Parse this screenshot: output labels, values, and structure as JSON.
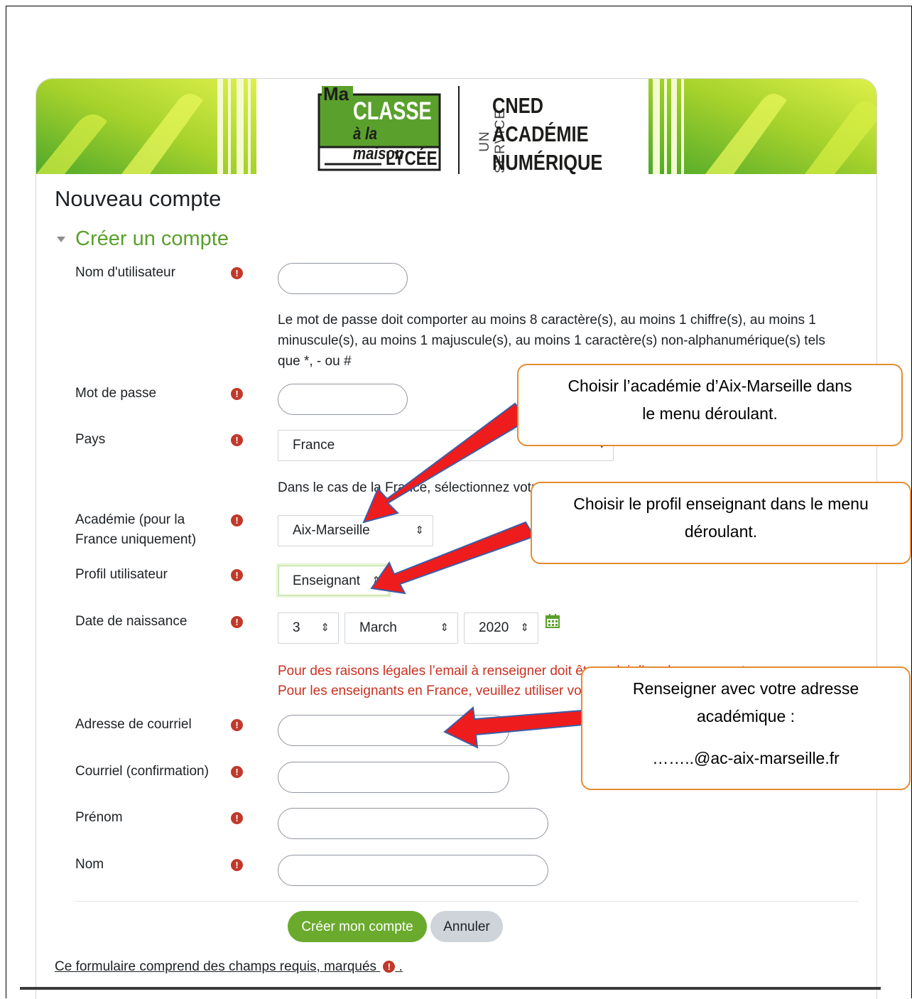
{
  "header": {
    "logo": {
      "line1": "Ma",
      "line2": "CLASSE",
      "line3": "à la maison",
      "line4": "LYCÉE"
    },
    "service_label": "UN SERVICE",
    "org_lines": [
      "CNED",
      "ACADÉMIE",
      "NUMÉRIQUE"
    ]
  },
  "page_title": "Nouveau compte",
  "section_title": "Créer un compte",
  "fields": {
    "username": {
      "label": "Nom d'utilisateur",
      "value": ""
    },
    "password_rule": "Le mot de passe doit comporter au moins 8 caractère(s), au moins 1 chiffre(s), au moins 1 minuscule(s), au moins 1 majuscule(s), au moins 1 caractère(s) non-alphanumérique(s) tels que *, - ou #",
    "password": {
      "label": "Mot de passe",
      "value": ""
    },
    "country": {
      "label": "Pays",
      "value": "France"
    },
    "country_help": "Dans le cas de la France, sélectionnez votre académie",
    "academy": {
      "label_line1": "Académie (pour la",
      "label_line2": "France uniquement)",
      "value": "Aix-Marseille"
    },
    "profile": {
      "label": "Profil utilisateur",
      "value": "Enseignant"
    },
    "birthdate": {
      "label": "Date de naissance",
      "day": "3",
      "month": "March",
      "year": "2020"
    },
    "email_notice_line1": "Pour des raisons légales l’email à renseigner doit être celui d’un de vos parents.",
    "email_notice_line2": "Pour les enseignants en France, veuillez utiliser votre adresse académique.",
    "email": {
      "label": "Adresse de courriel",
      "value": ""
    },
    "email_confirm": {
      "label": "Courriel (confirmation)",
      "value": ""
    },
    "firstname": {
      "label": "Prénom",
      "value": ""
    },
    "lastname": {
      "label": "Nom",
      "value": ""
    }
  },
  "actions": {
    "submit": "Créer mon compte",
    "cancel": "Annuler"
  },
  "footer_note": "Ce formulaire comprend des champs requis, marqués",
  "required_icon": "exclamation-circle-icon",
  "callouts": {
    "academy": {
      "line1": "Choisir l’académie d’Aix-Marseille dans",
      "line2": "le menu déroulant."
    },
    "profile": {
      "line1": "Choisir le profil enseignant dans le menu",
      "line2": "déroulant."
    },
    "email": {
      "line1": "Renseigner avec votre adresse",
      "line2": "académique :",
      "line3": "……..@ac-aix-marseille.fr"
    }
  },
  "colors": {
    "accent_green": "#6aab2e",
    "section_green": "#5aa02c",
    "required_red": "#c0392b",
    "notice_red": "#ca3120",
    "callout_border": "#e58b30",
    "arrow_red": "#ee1c1c"
  }
}
